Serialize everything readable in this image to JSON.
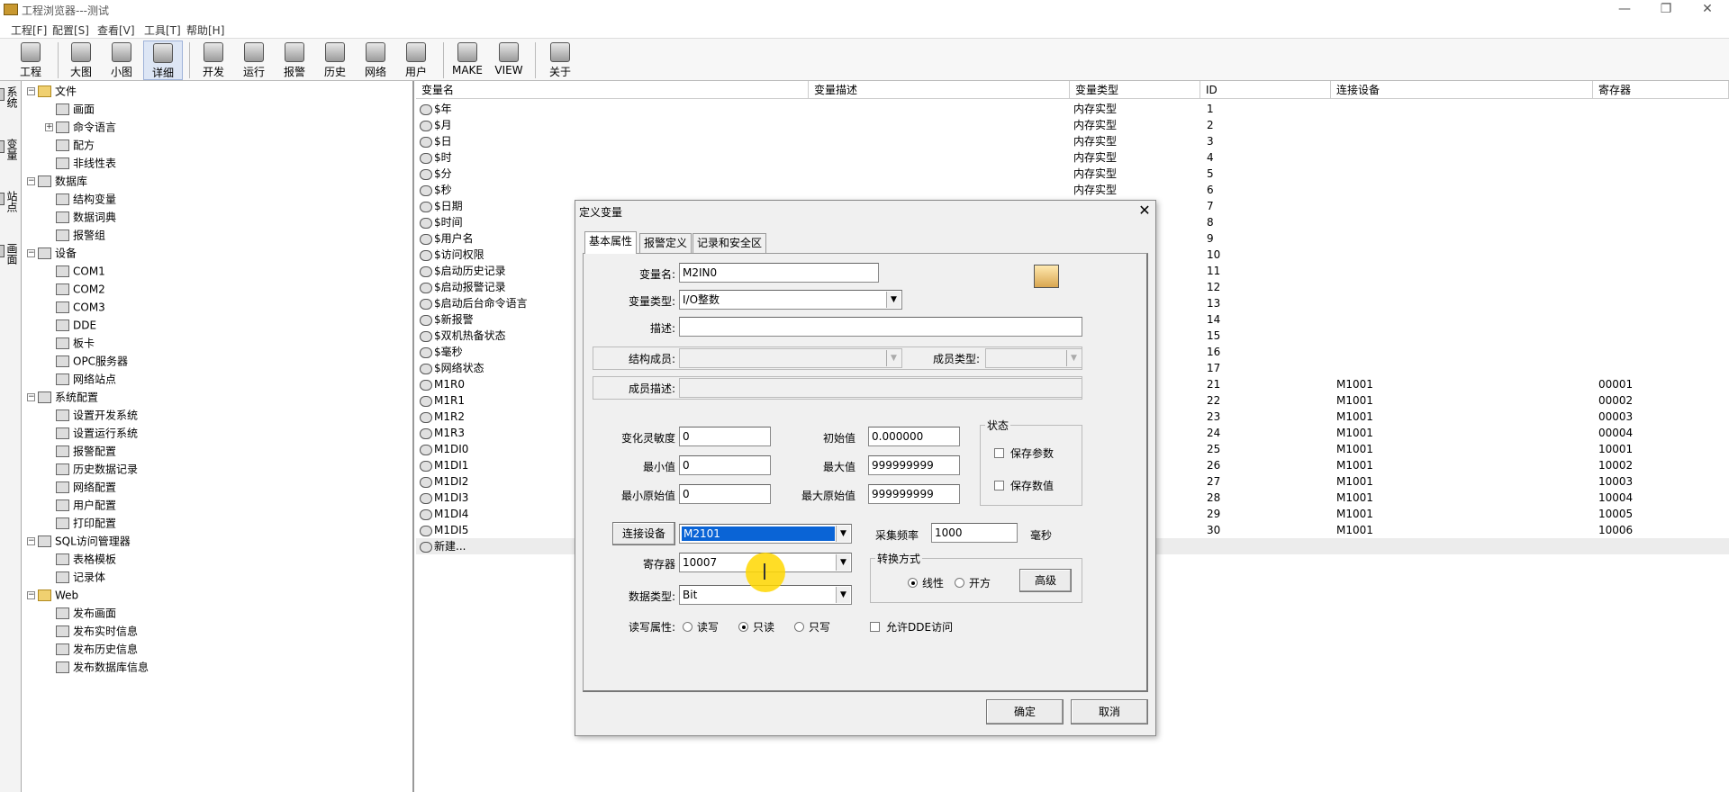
{
  "window": {
    "title": "工程浏览器---测试",
    "controls": [
      "—",
      "❐",
      "✕"
    ]
  },
  "menu": [
    "工程[F]",
    "配置[S]",
    "查看[V]",
    "工具[T]",
    "帮助[H]"
  ],
  "toolbar": [
    "工程",
    "大图",
    "小图",
    "详细",
    "开发",
    "运行",
    "报警",
    "历史",
    "网络",
    "用户",
    "MAKE",
    "VIEW",
    "关于"
  ],
  "vtabs": [
    "系统",
    "变量",
    "站点",
    "画面"
  ],
  "tree": [
    {
      "label": "文件",
      "level": 0,
      "exp": "−",
      "folder": true
    },
    {
      "label": "画面",
      "level": 1
    },
    {
      "label": "命令语言",
      "level": 1,
      "exp": "+"
    },
    {
      "label": "配方",
      "level": 1
    },
    {
      "label": "非线性表",
      "level": 1
    },
    {
      "label": "数据库",
      "level": 0,
      "exp": "−"
    },
    {
      "label": "结构变量",
      "level": 1
    },
    {
      "label": "数据词典",
      "level": 1
    },
    {
      "label": "报警组",
      "level": 1
    },
    {
      "label": "设备",
      "level": 0,
      "exp": "−"
    },
    {
      "label": "COM1",
      "level": 1
    },
    {
      "label": "COM2",
      "level": 1
    },
    {
      "label": "COM3",
      "level": 1
    },
    {
      "label": "DDE",
      "level": 1
    },
    {
      "label": "板卡",
      "level": 1
    },
    {
      "label": "OPC服务器",
      "level": 1
    },
    {
      "label": "网络站点",
      "level": 1
    },
    {
      "label": "系统配置",
      "level": 0,
      "exp": "−"
    },
    {
      "label": "设置开发系统",
      "level": 1
    },
    {
      "label": "设置运行系统",
      "level": 1
    },
    {
      "label": "报警配置",
      "level": 1
    },
    {
      "label": "历史数据记录",
      "level": 1
    },
    {
      "label": "网络配置",
      "level": 1
    },
    {
      "label": "用户配置",
      "level": 1
    },
    {
      "label": "打印配置",
      "level": 1
    },
    {
      "label": "SQL访问管理器",
      "level": 0,
      "exp": "−"
    },
    {
      "label": "表格模板",
      "level": 1
    },
    {
      "label": "记录体",
      "level": 1
    },
    {
      "label": "Web",
      "level": 0,
      "exp": "−",
      "folder": true
    },
    {
      "label": "发布画面",
      "level": 1
    },
    {
      "label": "发布实时信息",
      "level": 1
    },
    {
      "label": "发布历史信息",
      "level": 1
    },
    {
      "label": "发布数据库信息",
      "level": 1
    }
  ],
  "list": {
    "headers": [
      "变量名",
      "变量描述",
      "变量类型",
      "ID",
      "连接设备",
      "寄存器"
    ],
    "rows": [
      [
        "$年",
        "",
        "内存实型",
        "1",
        "",
        ""
      ],
      [
        "$月",
        "",
        "内存实型",
        "2",
        "",
        ""
      ],
      [
        "$日",
        "",
        "内存实型",
        "3",
        "",
        ""
      ],
      [
        "$时",
        "",
        "内存实型",
        "4",
        "",
        ""
      ],
      [
        "$分",
        "",
        "内存实型",
        "5",
        "",
        ""
      ],
      [
        "$秒",
        "",
        "内存实型",
        "6",
        "",
        ""
      ],
      [
        "$日期",
        "",
        "",
        "7",
        "",
        ""
      ],
      [
        "$时间",
        "",
        "",
        "8",
        "",
        ""
      ],
      [
        "$用户名",
        "",
        "",
        "9",
        "",
        ""
      ],
      [
        "$访问权限",
        "",
        "",
        "10",
        "",
        ""
      ],
      [
        "$启动历史记录",
        "",
        "",
        "11",
        "",
        ""
      ],
      [
        "$启动报警记录",
        "",
        "",
        "12",
        "",
        ""
      ],
      [
        "$启动后台命令语言",
        "",
        "",
        "13",
        "",
        ""
      ],
      [
        "$新报警",
        "",
        "",
        "14",
        "",
        ""
      ],
      [
        "$双机热备状态",
        "",
        "",
        "15",
        "",
        ""
      ],
      [
        "$毫秒",
        "",
        "",
        "16",
        "",
        ""
      ],
      [
        "$网络状态",
        "",
        "",
        "17",
        "",
        ""
      ],
      [
        "M1R0",
        "",
        "",
        "21",
        "M1001",
        "00001"
      ],
      [
        "M1R1",
        "",
        "",
        "22",
        "M1001",
        "00002"
      ],
      [
        "M1R2",
        "",
        "",
        "23",
        "M1001",
        "00003"
      ],
      [
        "M1R3",
        "",
        "",
        "24",
        "M1001",
        "00004"
      ],
      [
        "M1DI0",
        "",
        "",
        "25",
        "M1001",
        "10001"
      ],
      [
        "M1DI1",
        "",
        "",
        "26",
        "M1001",
        "10002"
      ],
      [
        "M1DI2",
        "",
        "",
        "27",
        "M1001",
        "10003"
      ],
      [
        "M1DI3",
        "",
        "",
        "28",
        "M1001",
        "10004"
      ],
      [
        "M1DI4",
        "",
        "",
        "29",
        "M1001",
        "10005"
      ],
      [
        "M1DI5",
        "",
        "",
        "30",
        "M1001",
        "10006"
      ]
    ],
    "new_row": "新建..."
  },
  "dialog": {
    "title": "定义变量",
    "close": "✕",
    "tabs": [
      "基本属性",
      "报警定义",
      "记录和安全区"
    ],
    "var_name_label": "变量名:",
    "var_name": "M2IN0",
    "var_type_label": "变量类型:",
    "var_type": "I/O整数",
    "desc_label": "描述:",
    "desc": "",
    "struct_member_label": "结构成员:",
    "member_type_label": "成员类型:",
    "member_desc_label": "成员描述:",
    "sensitivity_label": "变化灵敏度",
    "sensitivity": "0",
    "initial_label": "初始值",
    "initial": "0.000000",
    "min_label": "最小值",
    "min": "0",
    "max_label": "最大值",
    "max": "999999999",
    "min_raw_label": "最小原始值",
    "min_raw": "0",
    "max_raw_label": "最大原始值",
    "max_raw": "999999999",
    "status_group": "状态",
    "save_params": "保存参数",
    "save_values": "保存数值",
    "connect_device_button": "连接设备",
    "device": "M2101",
    "collect_freq_label": "采集频率",
    "collect_freq": "1000",
    "collect_unit": "毫秒",
    "register_label": "寄存器",
    "register": "10007",
    "convert_group": "转换方式",
    "linear": "线性",
    "sqrt": "开方",
    "advanced_button": "高级",
    "data_type_label": "数据类型:",
    "data_type": "Bit",
    "rw_label": "读写属性:",
    "rw_options": [
      "读写",
      "只读",
      "只写"
    ],
    "allow_dde": "允许DDE访问",
    "ok": "确定",
    "cancel": "取消"
  },
  "colors": {
    "selection": "#0a64d6",
    "cursor_highlight": "#ffd700"
  }
}
